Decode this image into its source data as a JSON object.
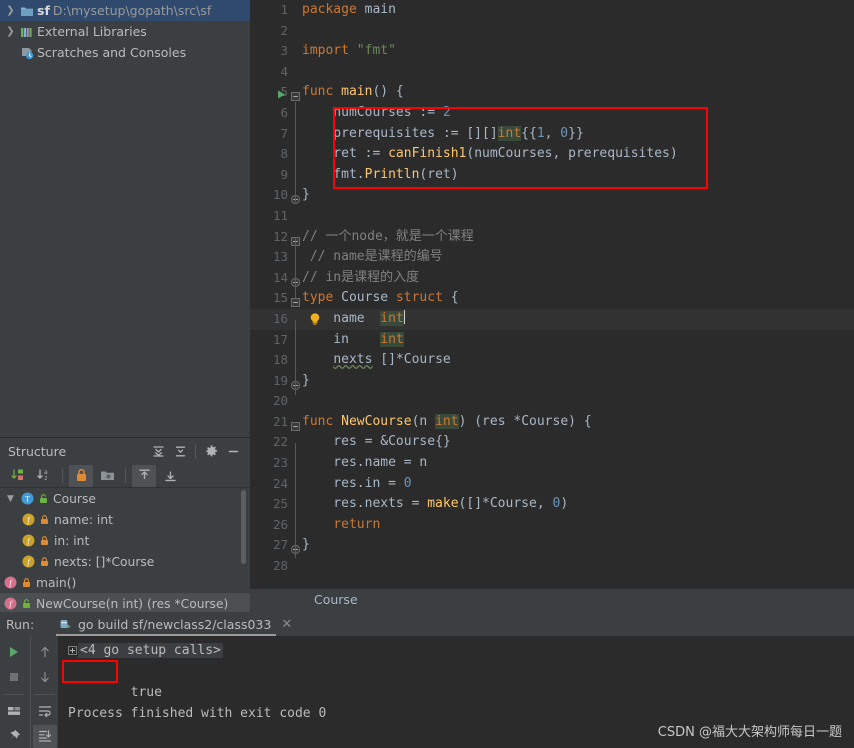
{
  "project": {
    "items": [
      {
        "twisty": "chevron-right-icon",
        "icon": "folder-module-icon",
        "name": "sf",
        "path": "D:\\mysetup\\gopath\\src\\sf",
        "selected": true
      },
      {
        "twisty": "chevron-right-icon",
        "icon": "external-libraries-icon",
        "name": "External Libraries",
        "path": "",
        "selected": false
      },
      {
        "twisty": "",
        "icon": "scratches-icon",
        "name": "Scratches and Consoles",
        "path": "",
        "selected": false
      }
    ]
  },
  "structure": {
    "title": "Structure",
    "header_buttons": [
      "expand-all-icon",
      "collapse-all-icon",
      "gear-icon",
      "minimize-icon"
    ],
    "toolbar_buttons": [
      "sort-by-visibility-icon",
      "sort-alphabetically-icon",
      "show-non-public-icon",
      "group-icon",
      "show-inherited-icon",
      "show-anonymous-icon"
    ],
    "items": [
      {
        "indent": 0,
        "twisty": "chevron-down-icon",
        "kind": "type-icon",
        "vis": "public-icon",
        "label": "Course",
        "selected": false
      },
      {
        "indent": 1,
        "twisty": "",
        "kind": "field-icon",
        "vis": "private-icon",
        "label": "name: int",
        "selected": false
      },
      {
        "indent": 1,
        "twisty": "",
        "kind": "field-icon",
        "vis": "private-icon",
        "label": "in: int",
        "selected": false
      },
      {
        "indent": 1,
        "twisty": "",
        "kind": "field-icon",
        "vis": "private-icon",
        "label": "nexts: []*Course",
        "selected": false
      },
      {
        "indent": 0,
        "twisty": "",
        "kind": "func-icon",
        "vis": "private-icon",
        "label": "main()",
        "selected": false
      },
      {
        "indent": 0,
        "twisty": "",
        "kind": "func-icon",
        "vis": "public-icon",
        "label": "NewCourse(n int) (res *Course)",
        "selected": true
      }
    ]
  },
  "editor": {
    "breadcrumb": "Course",
    "caret_line": 16,
    "lines": [
      {
        "n": 1,
        "tokens": [
          {
            "t": "package ",
            "c": "kw"
          },
          {
            "t": "main",
            "c": "ident"
          }
        ]
      },
      {
        "n": 2,
        "tokens": []
      },
      {
        "n": 3,
        "tokens": [
          {
            "t": "import ",
            "c": "kw"
          },
          {
            "t": "\"fmt\"",
            "c": "str"
          }
        ]
      },
      {
        "n": 4,
        "tokens": []
      },
      {
        "n": 5,
        "tokens": [
          {
            "t": "func ",
            "c": "kw"
          },
          {
            "t": "main",
            "c": "fn"
          },
          {
            "t": "() {",
            "c": "ident"
          }
        ],
        "gutter": "run-arrow-icon",
        "fold": "fold-open-icon"
      },
      {
        "n": 6,
        "tokens": [
          {
            "t": "    numCourses := ",
            "c": "ident"
          },
          {
            "t": "2",
            "c": "num"
          }
        ]
      },
      {
        "n": 7,
        "tokens": [
          {
            "t": "    prerequisites := [][]",
            "c": "ident"
          },
          {
            "t": "int",
            "c": "type-hl"
          },
          {
            "t": "{{",
            "c": "ident"
          },
          {
            "t": "1",
            "c": "num"
          },
          {
            "t": ", ",
            "c": "ident"
          },
          {
            "t": "0",
            "c": "num"
          },
          {
            "t": "}}",
            "c": "ident"
          }
        ]
      },
      {
        "n": 8,
        "tokens": [
          {
            "t": "    ret := ",
            "c": "ident"
          },
          {
            "t": "canFinish1",
            "c": "fn"
          },
          {
            "t": "(numCourses, prerequisites)",
            "c": "ident"
          }
        ]
      },
      {
        "n": 9,
        "tokens": [
          {
            "t": "    fmt.",
            "c": "ident"
          },
          {
            "t": "Println",
            "c": "fn"
          },
          {
            "t": "(ret)",
            "c": "ident"
          }
        ]
      },
      {
        "n": 10,
        "tokens": [
          {
            "t": "}",
            "c": "ident"
          }
        ],
        "fold": "fold-close-icon"
      },
      {
        "n": 11,
        "tokens": []
      },
      {
        "n": 12,
        "tokens": [
          {
            "t": "// 一个node，就是一个课程",
            "c": "cmt"
          }
        ],
        "fold": "fold-open-icon"
      },
      {
        "n": 13,
        "tokens": [
          {
            "t": " // name是课程的编号",
            "c": "cmt"
          }
        ]
      },
      {
        "n": 14,
        "tokens": [
          {
            "t": "// in是课程的入度",
            "c": "cmt"
          }
        ],
        "fold": "fold-close-icon"
      },
      {
        "n": 15,
        "tokens": [
          {
            "t": "type ",
            "c": "kw"
          },
          {
            "t": "Course ",
            "c": "ident"
          },
          {
            "t": "struct ",
            "c": "kw"
          },
          {
            "t": "{",
            "c": "ident"
          }
        ],
        "fold": "fold-open-icon"
      },
      {
        "n": 16,
        "tokens": [
          {
            "t": "    name  ",
            "c": "ident"
          },
          {
            "t": "int",
            "c": "type-hl"
          }
        ],
        "gutter": "lightbulb-icon",
        "highlight": true,
        "caret": true
      },
      {
        "n": 17,
        "tokens": [
          {
            "t": "    in    ",
            "c": "ident"
          },
          {
            "t": "int",
            "c": "type-hl"
          }
        ]
      },
      {
        "n": 18,
        "tokens": [
          {
            "t": "    ",
            "c": "ident"
          },
          {
            "t": "nexts",
            "c": "fieldu"
          },
          {
            "t": " []*",
            "c": "ident"
          },
          {
            "t": "Course",
            "c": "typ"
          }
        ]
      },
      {
        "n": 19,
        "tokens": [
          {
            "t": "}",
            "c": "ident"
          }
        ],
        "fold": "fold-close-icon"
      },
      {
        "n": 20,
        "tokens": []
      },
      {
        "n": 21,
        "tokens": [
          {
            "t": "func ",
            "c": "kw"
          },
          {
            "t": "NewCourse",
            "c": "fn"
          },
          {
            "t": "(n ",
            "c": "ident"
          },
          {
            "t": "int",
            "c": "type-hl"
          },
          {
            "t": ") (res *",
            "c": "ident"
          },
          {
            "t": "Course",
            "c": "typ"
          },
          {
            "t": ") {",
            "c": "ident"
          }
        ],
        "fold": "fold-open-icon"
      },
      {
        "n": 22,
        "tokens": [
          {
            "t": "    res = &",
            "c": "ident"
          },
          {
            "t": "Course",
            "c": "typ"
          },
          {
            "t": "{}",
            "c": "ident"
          }
        ]
      },
      {
        "n": 23,
        "tokens": [
          {
            "t": "    res.name = n",
            "c": "ident"
          }
        ]
      },
      {
        "n": 24,
        "tokens": [
          {
            "t": "    res.in = ",
            "c": "ident"
          },
          {
            "t": "0",
            "c": "num"
          }
        ]
      },
      {
        "n": 25,
        "tokens": [
          {
            "t": "    res.nexts = ",
            "c": "ident"
          },
          {
            "t": "make",
            "c": "fn"
          },
          {
            "t": "([]*",
            "c": "ident"
          },
          {
            "t": "Course",
            "c": "typ"
          },
          {
            "t": ", ",
            "c": "ident"
          },
          {
            "t": "0",
            "c": "num"
          },
          {
            "t": ")",
            "c": "ident"
          }
        ]
      },
      {
        "n": 26,
        "tokens": [
          {
            "t": "    ",
            "c": "ident"
          },
          {
            "t": "return",
            "c": "kw"
          }
        ]
      },
      {
        "n": 27,
        "tokens": [
          {
            "t": "}",
            "c": "ident"
          }
        ],
        "fold": "fold-close-icon"
      },
      {
        "n": 28,
        "tokens": []
      }
    ],
    "highlight_box_label": "code-highlight-box"
  },
  "run": {
    "label": "Run:",
    "tab_icon": "go-run-config-icon",
    "tab_title": "go build sf/newclass2/class033",
    "close_icon": "close-icon",
    "left_tools": [
      "rerun-icon",
      "stop-icon",
      "layout-icon",
      "pin-icon"
    ],
    "nav_tools": [
      "up-arrow-icon",
      "down-arrow-icon",
      "soft-wrap-icon",
      "scroll-to-end-icon"
    ],
    "console": {
      "setup_line": "<4 go setup calls>",
      "output_line": "true",
      "blank_line": "",
      "exit_line": "Process finished with exit code 0"
    }
  },
  "watermark": "CSDN @福大大架构师每日一题",
  "colors": {
    "accent_red": "#ff0000",
    "panel_bg": "#3c3f41",
    "editor_bg": "#2b2b2b",
    "selection_blue": "#2f4a6d",
    "keyword_orange": "#cc7832",
    "string_green": "#6a8759",
    "number_blue": "#6897bb",
    "function_yellow": "#ffc66d"
  }
}
